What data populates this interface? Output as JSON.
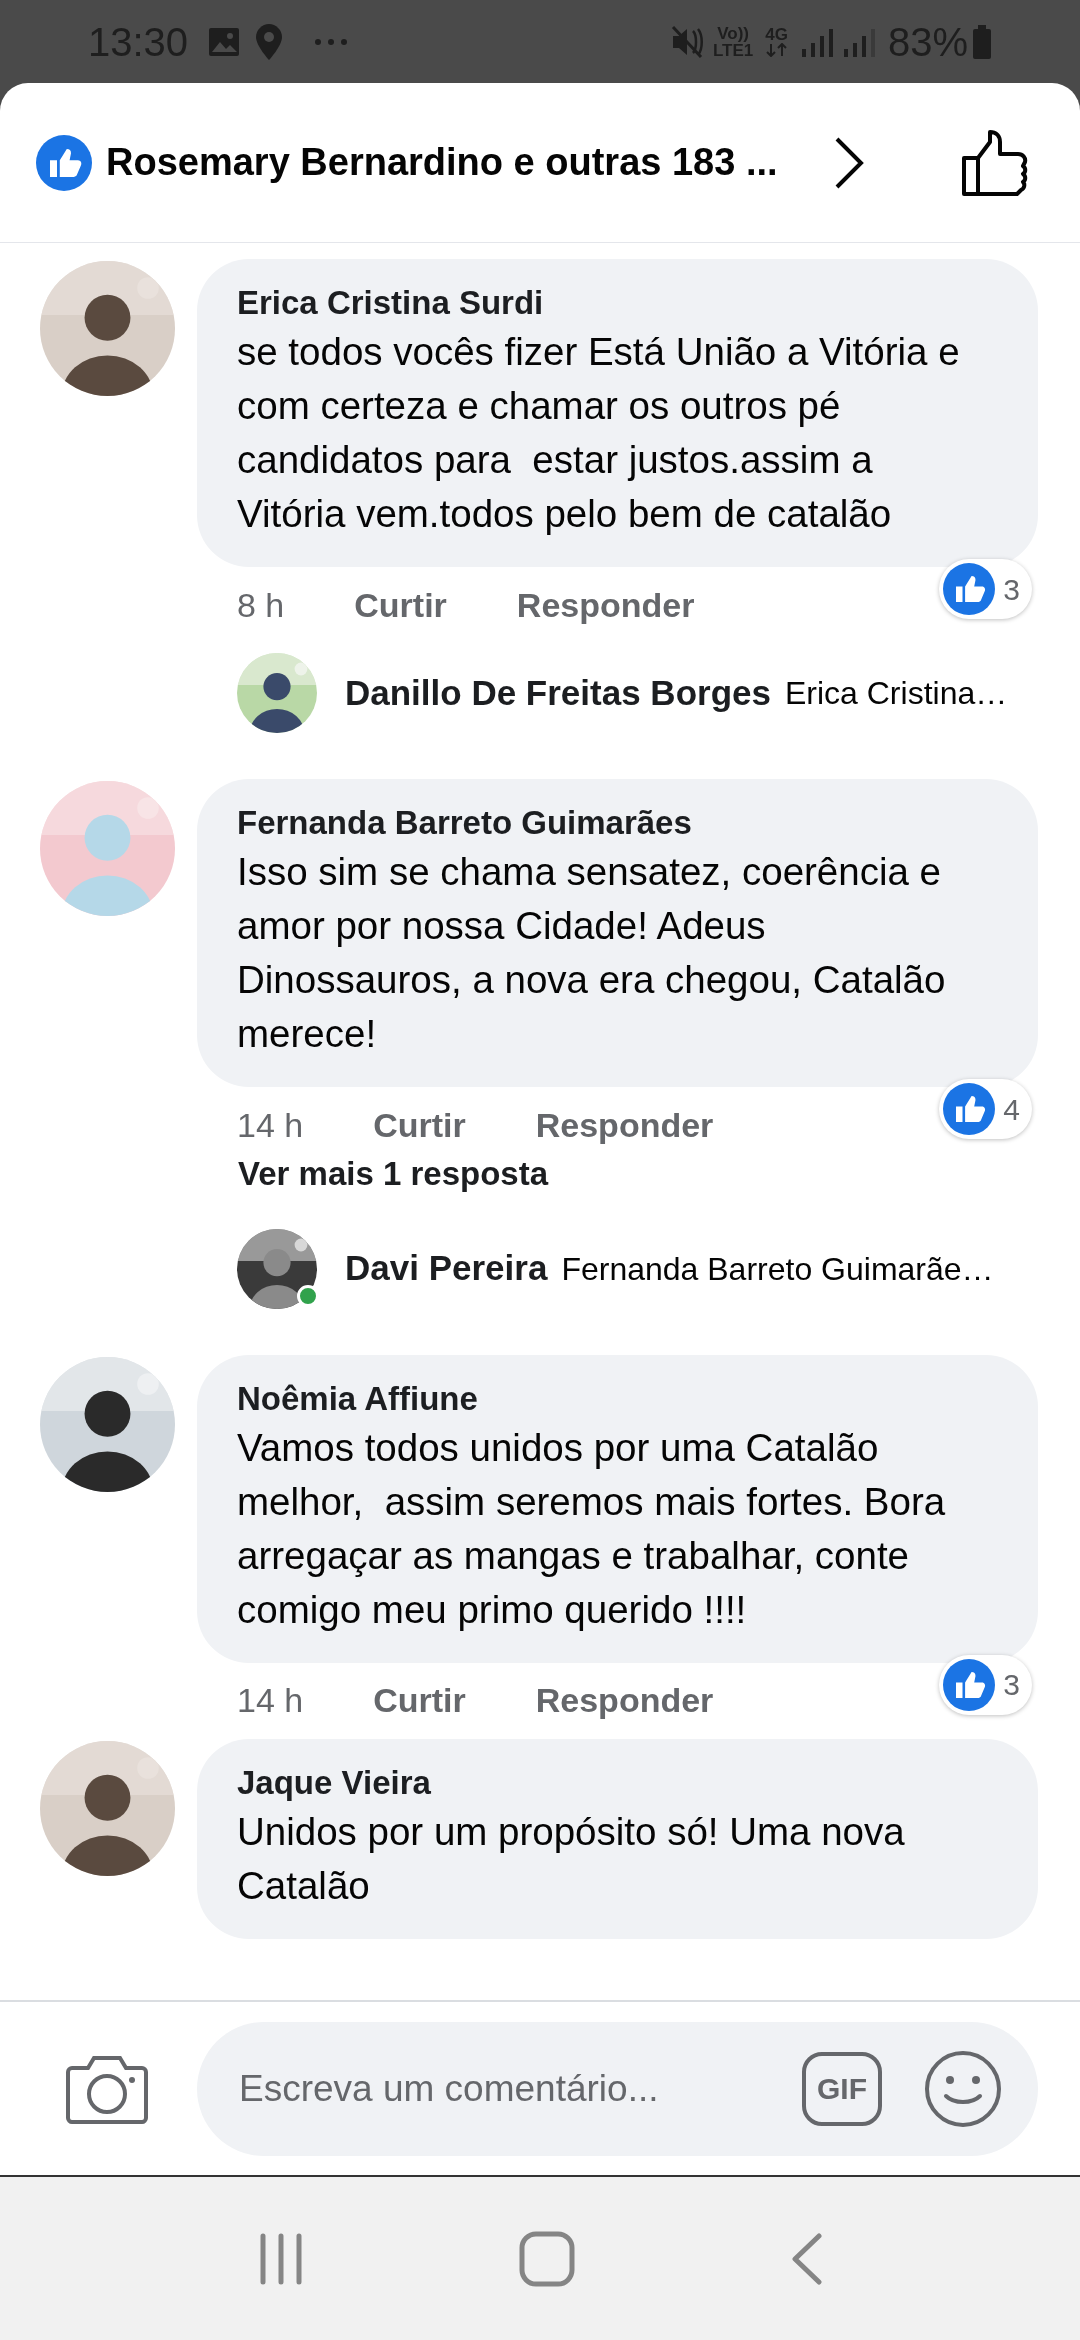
{
  "status_bar": {
    "time": "13:30",
    "network_top": "Vo))",
    "network_bottom": "LTE1",
    "data_type": "4G",
    "battery": "83%"
  },
  "header": {
    "title": "Rosemary Bernardino e outras 183 ..."
  },
  "comments": [
    {
      "kind": "comment",
      "name": "Erica Cristina Surdi",
      "text": "se todos vocês fizer Está União a Vitória e com certeza e chamar os outros pé  candidatos para  estar justos.assim a Vitória vem.todos pelo bem de catalão",
      "time": "8 h",
      "like": "Curtir",
      "reply": "Responder",
      "reactions": "3"
    },
    {
      "kind": "reply",
      "name": "Danillo De Freitas Borges",
      "preview": "Erica Cristina…",
      "online": false
    },
    {
      "kind": "comment",
      "name": "Fernanda Barreto Guimarães",
      "text": "Isso sim se chama sensatez, coerência e amor por nossa Cidade! Adeus Dinossauros, a nova era chegou, Catalão merece!",
      "time": "14 h",
      "like": "Curtir",
      "reply": "Responder",
      "reactions": "4"
    },
    {
      "kind": "more",
      "label": "Ver mais 1 resposta"
    },
    {
      "kind": "reply",
      "name": "Davi Pereira",
      "preview": "Fernanda Barreto Guimarãe…",
      "online": true
    },
    {
      "kind": "comment",
      "name": "Noêmia Affiune",
      "text": "Vamos todos unidos por uma Catalão melhor,  assim seremos mais fortes. Bora arregaçar as mangas e trabalhar, conte comigo meu primo querido !!!!",
      "time": "14 h",
      "like": "Curtir",
      "reply": "Responder",
      "reactions": "3"
    },
    {
      "kind": "comment",
      "name": "Jaque Vieira",
      "text": "Unidos por um propósito só! Uma nova Catalão"
    }
  ],
  "composer": {
    "placeholder": "Escreva um comentário...",
    "gif": "GIF"
  }
}
